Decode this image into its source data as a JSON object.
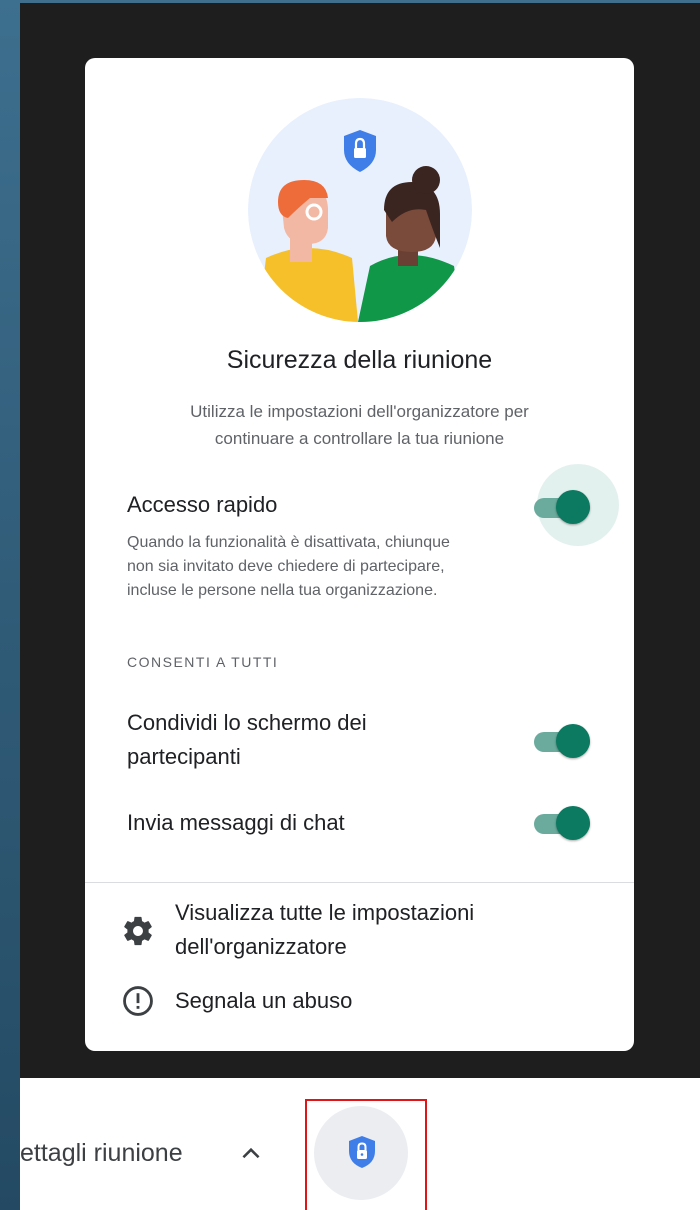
{
  "dialog": {
    "title": "Sicurezza della riunione",
    "description_line1": "Utilizza le impostazioni dell'organizzatore per",
    "description_line2": "continuare a controllare la tua riunione",
    "quick_access": {
      "label": "Accesso rapido",
      "help_line1": "Quando la funzionalità è disattivata, chiunque",
      "help_line2": "non sia invitato deve chiedere di partecipare,",
      "help_line3": "incluse le persone nella tua organizzazione.",
      "enabled": true
    },
    "section_header": "CONSENTI A TUTTI",
    "share_screen": {
      "label_line1": "Condividi lo schermo dei",
      "label_line2": "partecipanti",
      "enabled": true
    },
    "chat": {
      "label": "Invia messaggi di chat",
      "enabled": true
    },
    "view_settings": {
      "line1": "Visualizza tutte le impostazioni",
      "line2": "dell'organizzatore",
      "icon": "gear-icon"
    },
    "report_abuse": {
      "label": "Segnala un abuso",
      "icon": "alert-circle-icon"
    }
  },
  "bottom_bar": {
    "meeting_details": "ettagli riunione",
    "chevron_icon": "chevron-up-icon",
    "security_icon": "shield-lock-icon"
  },
  "colors": {
    "toggle_on": "#0b7a60",
    "toggle_track": "#6aab9d",
    "shield": "#3f7ee8",
    "highlight": "#e01616"
  }
}
